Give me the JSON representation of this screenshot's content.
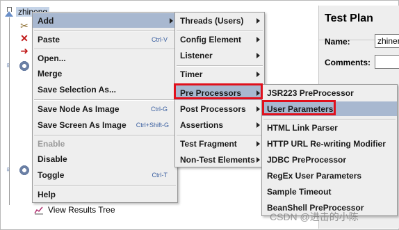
{
  "tree": {
    "root_label": "zhineng",
    "view_results_tree": "View Results Tree"
  },
  "panel": {
    "title": "Test Plan",
    "name_label": "Name:",
    "name_value": "zhiner",
    "comments_label": "Comments:"
  },
  "menu1": {
    "items": [
      {
        "label": "Add",
        "shortcut": "",
        "has_sub": true,
        "disabled": false
      },
      {
        "label": "Paste",
        "shortcut": "Ctrl-V",
        "has_sub": false,
        "disabled": false
      },
      {
        "label": "Open...",
        "shortcut": "",
        "has_sub": false,
        "disabled": false
      },
      {
        "label": "Merge",
        "shortcut": "",
        "has_sub": false,
        "disabled": false
      },
      {
        "label": "Save Selection As...",
        "shortcut": "",
        "has_sub": false,
        "disabled": false
      },
      {
        "label": "Save Node As Image",
        "shortcut": "Ctrl-G",
        "has_sub": false,
        "disabled": false
      },
      {
        "label": "Save Screen As Image",
        "shortcut": "Ctrl+Shift-G",
        "has_sub": false,
        "disabled": false
      },
      {
        "label": "Enable",
        "shortcut": "",
        "has_sub": false,
        "disabled": true
      },
      {
        "label": "Disable",
        "shortcut": "",
        "has_sub": false,
        "disabled": false
      },
      {
        "label": "Toggle",
        "shortcut": "Ctrl-T",
        "has_sub": false,
        "disabled": false
      },
      {
        "label": "Help",
        "shortcut": "",
        "has_sub": false,
        "disabled": false
      }
    ]
  },
  "menu2": {
    "items": [
      {
        "label": "Threads (Users)",
        "has_sub": true
      },
      {
        "label": "Config Element",
        "has_sub": true
      },
      {
        "label": "Listener",
        "has_sub": true
      },
      {
        "label": "Timer",
        "has_sub": true
      },
      {
        "label": "Pre Processors",
        "has_sub": true
      },
      {
        "label": "Post Processors",
        "has_sub": true
      },
      {
        "label": "Assertions",
        "has_sub": true
      },
      {
        "label": "Test Fragment",
        "has_sub": true
      },
      {
        "label": "Non-Test Elements",
        "has_sub": true
      }
    ]
  },
  "menu3": {
    "items": [
      {
        "label": "JSR223 PreProcessor"
      },
      {
        "label": "User Parameters"
      },
      {
        "label": "HTML Link Parser"
      },
      {
        "label": "HTTP URL Re-writing Modifier"
      },
      {
        "label": "JDBC PreProcessor"
      },
      {
        "label": "RegEx User Parameters"
      },
      {
        "label": "Sample Timeout"
      },
      {
        "label": "BeanShell PreProcessor"
      }
    ]
  },
  "watermark": "CSDN @进击的小陈",
  "colors": {
    "highlight": "#a8b8d0",
    "red_outline": "#e0101c",
    "menu_bg": "#eeeeee"
  }
}
